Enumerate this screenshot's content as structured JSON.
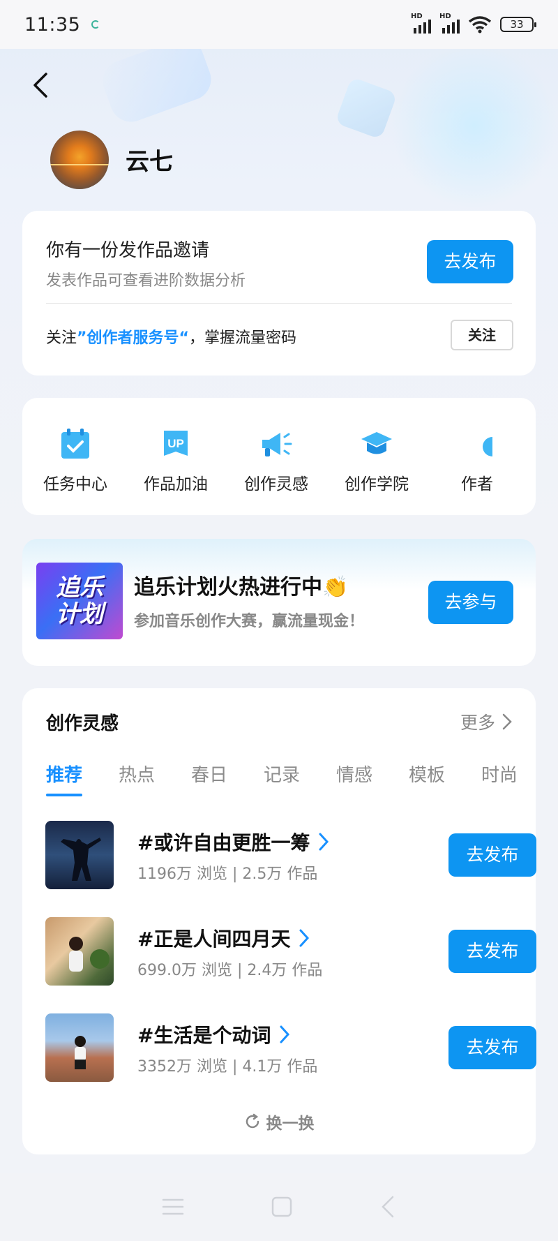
{
  "status_bar": {
    "time": "11:35",
    "battery": "33"
  },
  "profile": {
    "name": "云七"
  },
  "invite": {
    "title": "你有一份发作品邀请",
    "subtitle": "发表作品可查看进阶数据分析",
    "publish_label": "去发布",
    "follow_prefix": "关注",
    "follow_highlight": "”创作者服务号“",
    "follow_suffix": "，掌握流量密码",
    "follow_button": "关注"
  },
  "tools": [
    {
      "label": "任务中心",
      "icon": "calendar-check-icon"
    },
    {
      "label": "作品加油",
      "icon": "up-badge-icon"
    },
    {
      "label": "创作灵感",
      "icon": "megaphone-icon"
    },
    {
      "label": "创作学院",
      "icon": "graduation-cap-icon"
    },
    {
      "label": "作者",
      "icon": "partial-icon"
    }
  ],
  "promo": {
    "image_text_line1": "追乐",
    "image_text_line2": "计划",
    "title": "追乐计划火热进行中👏",
    "subtitle": "参加音乐创作大赛，赢流量现金！",
    "button": "去参与"
  },
  "inspiration": {
    "title": "创作灵感",
    "more": "更多",
    "tabs": [
      "推荐",
      "热点",
      "春日",
      "记录",
      "情感",
      "模板",
      "时尚"
    ],
    "topics": [
      {
        "name": "#或许自由更胜一筹",
        "stats": "1196万 浏览 | 2.5万 作品",
        "button": "去发布"
      },
      {
        "name": "#正是人间四月天",
        "stats": "699.0万 浏览 | 2.4万 作品",
        "button": "去发布"
      },
      {
        "name": "#生活是个动词",
        "stats": "3352万 浏览 | 4.1万 作品",
        "button": "去发布"
      }
    ],
    "refresh": "换一换"
  },
  "colors": {
    "accent": "#1890ff",
    "button_blue": "#0d95f2"
  }
}
